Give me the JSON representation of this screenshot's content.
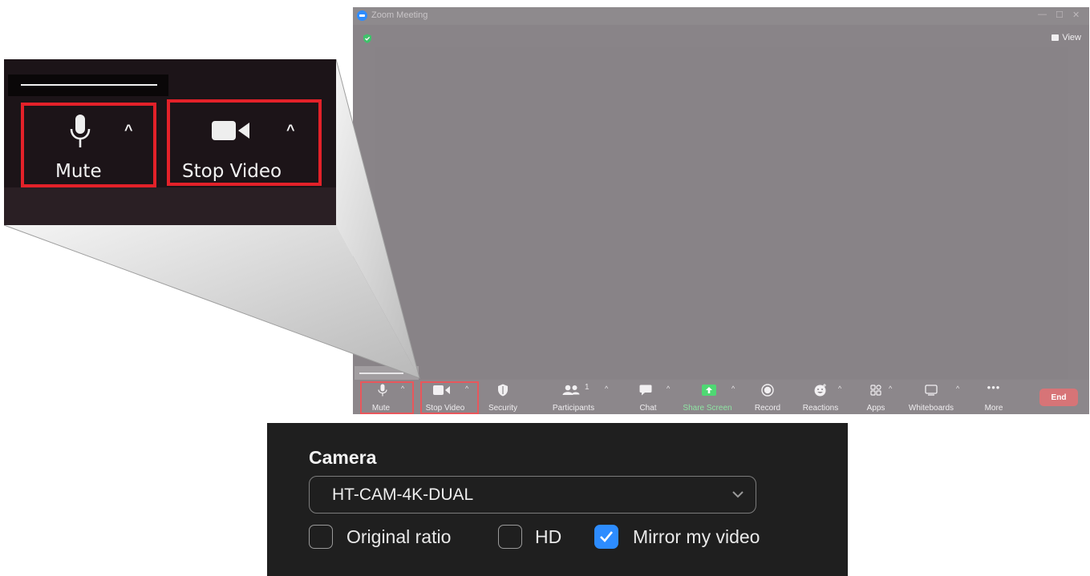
{
  "zoom_window": {
    "title": "Zoom Meeting",
    "view_label": "View",
    "toolbar": {
      "mute_label": "Mute",
      "stop_video_label": "Stop Video",
      "security_label": "Security",
      "participants_label": "Participants",
      "participants_count": "1",
      "chat_label": "Chat",
      "share_screen_label": "Share Screen",
      "record_label": "Record",
      "reactions_label": "Reactions",
      "apps_label": "Apps",
      "whiteboards_label": "Whiteboards",
      "more_label": "More",
      "end_label": "End"
    }
  },
  "callout": {
    "mute_label": "Mute",
    "stop_video_label": "Stop Video"
  },
  "camera_settings": {
    "heading": "Camera",
    "selected_camera": "HT-CAM-4K-DUAL",
    "options": [
      {
        "label": "Original ratio",
        "checked": false
      },
      {
        "label": "HD",
        "checked": false
      },
      {
        "label": "Mirror my video",
        "checked": true
      }
    ]
  },
  "colors": {
    "highlight": "#e32129",
    "zoom_blue": "#2d8cff",
    "end_button": "#d77477",
    "share_green": "#8fe3a3"
  }
}
